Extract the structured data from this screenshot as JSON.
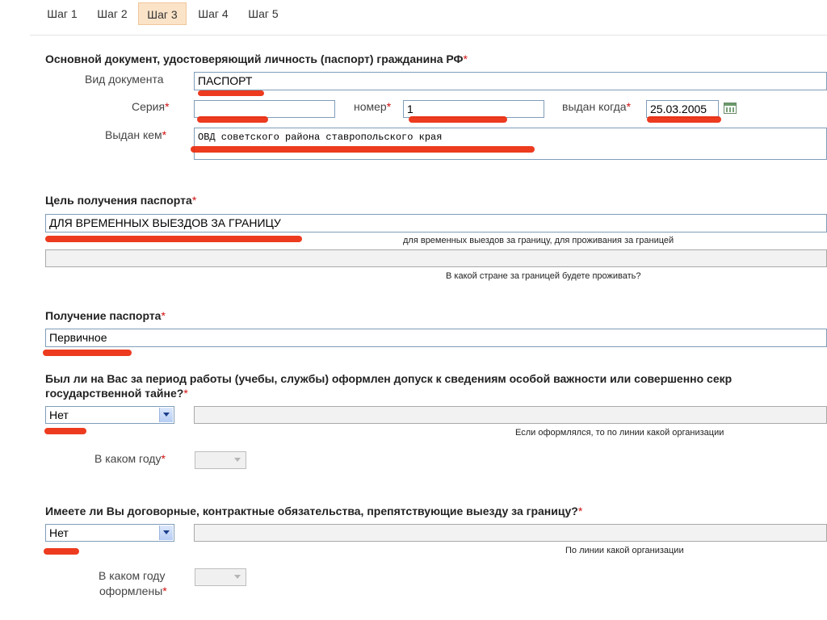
{
  "tabs": [
    {
      "label": "Шаг 1"
    },
    {
      "label": "Шаг 2"
    },
    {
      "label": "Шаг 3"
    },
    {
      "label": "Шаг 4"
    },
    {
      "label": "Шаг 5"
    }
  ],
  "active_tab": "Шаг 3",
  "required_mark": "*",
  "passport": {
    "heading": "Основной документ, удостоверяющий личность (паспорт) гражданина РФ",
    "doc_type_label": "Вид документа",
    "doc_type_value": "ПАСПОРТ",
    "series_label": "Серия",
    "series_value": "",
    "number_label": "номер",
    "number_value": "1",
    "issued_date_label": "выдан когда",
    "issued_date_value": "25.03.2005",
    "issued_by_label": "Выдан кем",
    "issued_by_value": "ОВД советского района ставропольского края"
  },
  "purpose": {
    "heading": "Цель получения паспорта",
    "value": "ДЛЯ ВРЕМЕННЫХ ВЫЕЗДОВ ЗА ГРАНИЦУ",
    "hint": "для временных выездов за границу, для проживания за границей",
    "country_value": "",
    "country_hint": "В какой стране за границей будете проживать?"
  },
  "receipt": {
    "heading": "Получение паспорта",
    "value": "Первичное"
  },
  "clearance": {
    "heading_line1": "Был ли на Вас за период работы (учебы, службы) оформлен допуск к сведениям особой важности или совершенно секр",
    "heading_line2": "государственной тайне?",
    "select_value": "Нет",
    "org_value": "",
    "org_hint": "Если оформлялся, то по линии какой организации",
    "year_label": "В каком году",
    "year_value": ""
  },
  "obligations": {
    "heading": "Имеете ли Вы договорные, контрактные обязательства, препятствующие выезду за границу?",
    "select_value": "Нет",
    "org_value": "",
    "org_hint": "По линии какой организации",
    "year_label_line1": "В каком году",
    "year_label_line2": "оформлены",
    "year_value": ""
  },
  "colors": {
    "accent_tab": "#fbe3c8",
    "required": "#d01010",
    "input_border": "#7f9db9",
    "redaction": "#ec2a0c"
  }
}
